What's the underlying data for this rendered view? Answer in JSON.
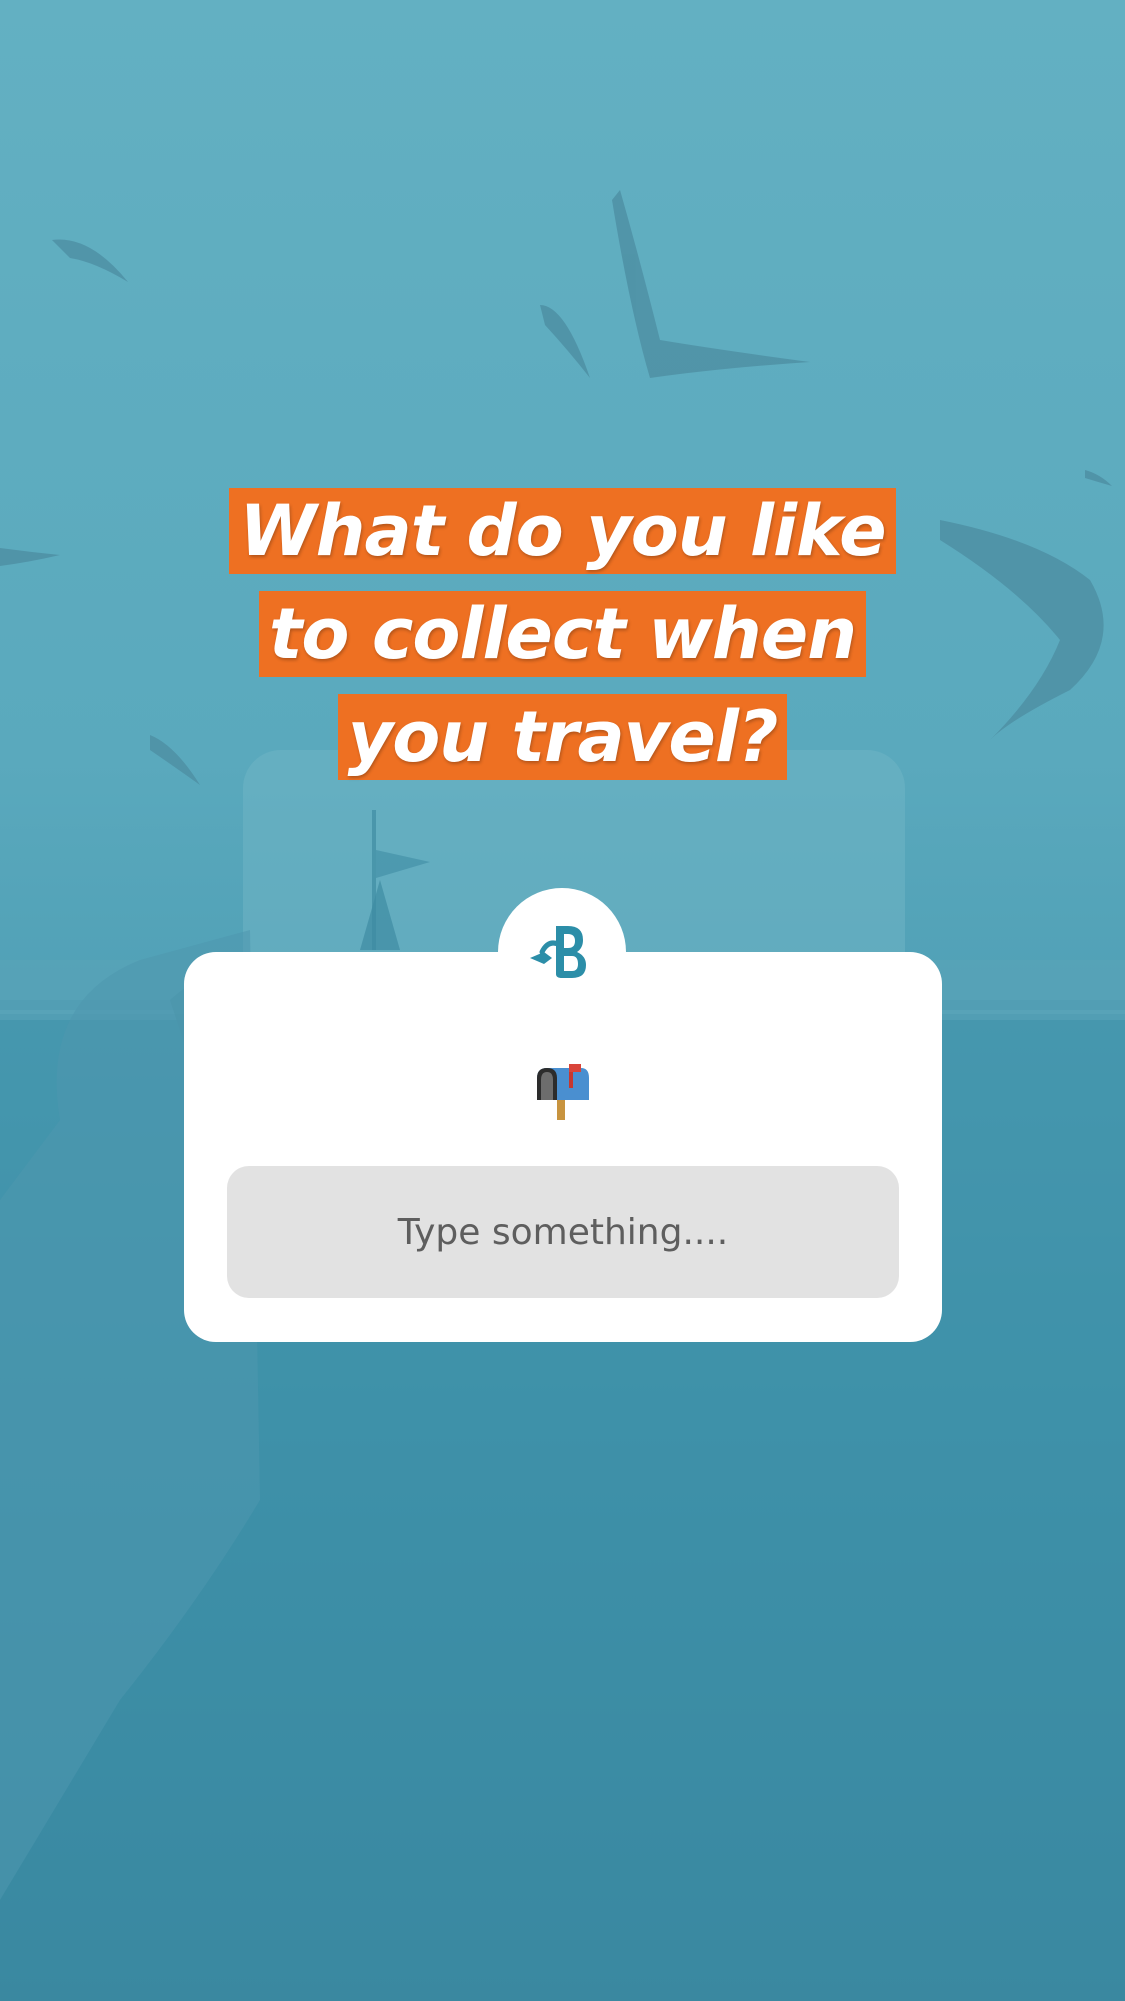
{
  "question": {
    "lines": [
      "What do you like",
      "to collect when",
      "you travel?"
    ]
  },
  "badge_icon": "brand-logo-b-icon",
  "emoji_icon": "mailbox-with-raised-flag-icon",
  "response_input": {
    "placeholder": "Type something...."
  },
  "colors": {
    "background": "#5aa9bd",
    "question_highlight": "#ee7022",
    "question_text": "#ffffff",
    "card": "#ffffff",
    "input_fill": "#e2e2e2",
    "brand_teal": "#2c8ea8"
  }
}
